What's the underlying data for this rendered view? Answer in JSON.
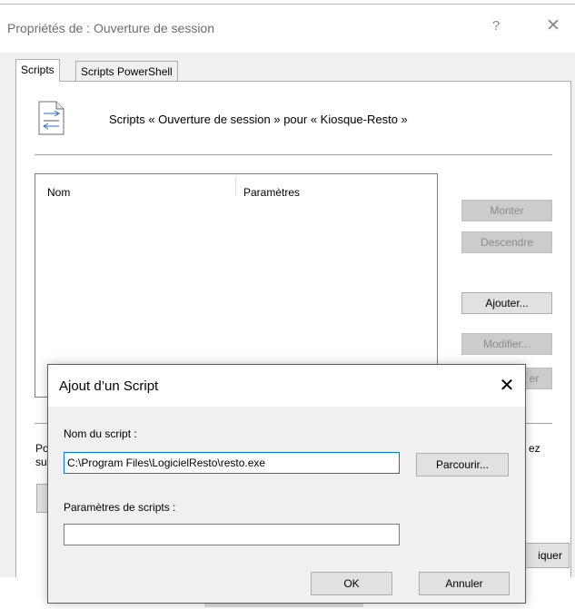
{
  "parent": {
    "title": "Propriétés de : Ouverture de session",
    "help_glyph": "?",
    "close_glyph": "✕",
    "tabs": [
      {
        "label": "Scripts"
      },
      {
        "label": "Scripts PowerShell"
      }
    ],
    "header_text": "Scripts « Ouverture de session » pour « Kiosque-Resto »",
    "columns": {
      "name": "Nom",
      "params": "Paramètres"
    },
    "buttons": {
      "up": "Monter",
      "down": "Descendre",
      "add": "Ajouter...",
      "edit": "Modifier...",
      "remove_fragment": "er",
      "apply_fragment": "iquer"
    },
    "fragments": {
      "line1_left": "Po",
      "line2_left": "su",
      "line1_right": "ez"
    }
  },
  "modal": {
    "title": "Ajout d’un Script",
    "close_glyph": "✕",
    "script_name_label": "Nom du script :",
    "script_name_value": "C:\\Program Files\\LogicielResto\\resto.exe",
    "browse_label": "Parcourir...",
    "params_label": "Paramètres de scripts :",
    "params_value": "",
    "ok_label": "OK",
    "cancel_label": "Annuler"
  },
  "icons": {
    "script_icon": "script-document-icon"
  }
}
